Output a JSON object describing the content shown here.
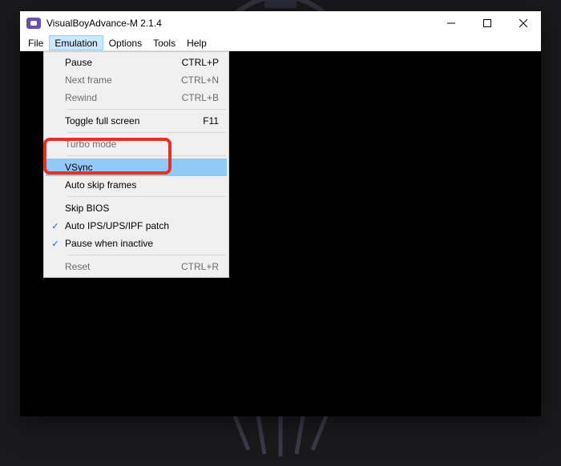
{
  "window": {
    "title": "VisualBoyAdvance-M 2.1.4"
  },
  "menubar": {
    "items": [
      {
        "label": "File",
        "open": false
      },
      {
        "label": "Emulation",
        "open": true
      },
      {
        "label": "Options",
        "open": false
      },
      {
        "label": "Tools",
        "open": false
      },
      {
        "label": "Help",
        "open": false
      }
    ]
  },
  "dropdown": {
    "groups": [
      [
        {
          "label": "Pause",
          "accel": "CTRL+P",
          "checked": false,
          "disabled": false,
          "hovered": false
        },
        {
          "label": "Next frame",
          "accel": "CTRL+N",
          "checked": false,
          "disabled": true,
          "hovered": false
        },
        {
          "label": "Rewind",
          "accel": "CTRL+B",
          "checked": false,
          "disabled": true,
          "hovered": false
        }
      ],
      [
        {
          "label": "Toggle full screen",
          "accel": "F11",
          "checked": false,
          "disabled": false,
          "hovered": false
        }
      ],
      [
        {
          "label": "Turbo mode",
          "accel": "",
          "checked": false,
          "disabled": true,
          "hovered": false
        }
      ],
      [
        {
          "label": "VSync",
          "accel": "",
          "checked": false,
          "disabled": false,
          "hovered": true
        },
        {
          "label": "Auto skip frames",
          "accel": "",
          "checked": false,
          "disabled": false,
          "hovered": false
        }
      ],
      [
        {
          "label": "Skip BIOS",
          "accel": "",
          "checked": false,
          "disabled": false,
          "hovered": false
        },
        {
          "label": "Auto IPS/UPS/IPF patch",
          "accel": "",
          "checked": true,
          "disabled": false,
          "hovered": false
        },
        {
          "label": "Pause when inactive",
          "accel": "",
          "checked": true,
          "disabled": false,
          "hovered": false
        }
      ],
      [
        {
          "label": "Reset",
          "accel": "CTRL+R",
          "checked": false,
          "disabled": true,
          "hovered": false
        }
      ]
    ]
  }
}
